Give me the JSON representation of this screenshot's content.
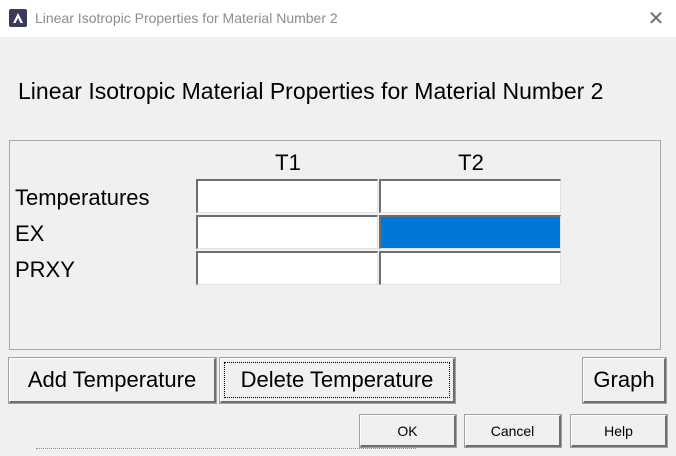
{
  "window": {
    "title": "Linear Isotropic Properties for Material Number 2",
    "close_glyph": "✕"
  },
  "heading": "Linear Isotropic Material Properties for Material Number 2",
  "table": {
    "columns": [
      "T1",
      "T2"
    ],
    "rows": [
      {
        "label": "Temperatures",
        "values": [
          "",
          ""
        ]
      },
      {
        "label": "EX",
        "values": [
          "",
          ""
        ]
      },
      {
        "label": "PRXY",
        "values": [
          "",
          ""
        ]
      }
    ],
    "selected_cell": {
      "row": "EX",
      "column": "T2"
    },
    "selection_color": "#0078d7"
  },
  "buttons": {
    "add_temperature": "Add Temperature",
    "delete_temperature": "Delete Temperature",
    "graph": "Graph",
    "ok": "OK",
    "cancel": "Cancel",
    "help": "Help"
  }
}
